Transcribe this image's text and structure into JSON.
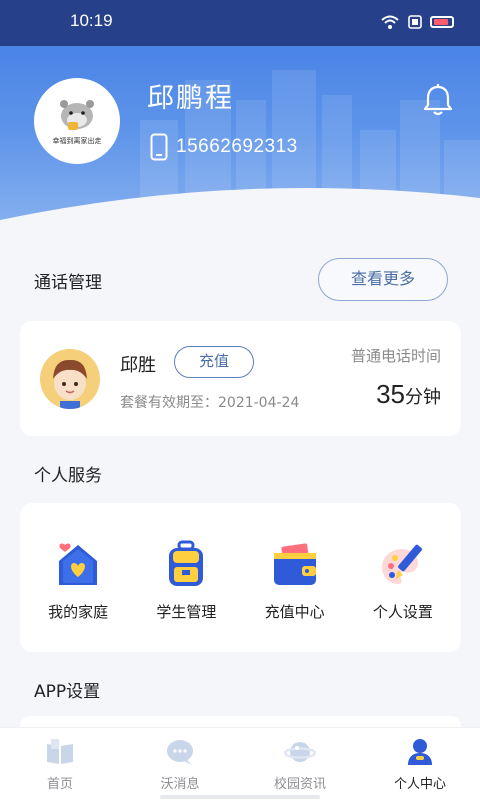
{
  "status_bar": {
    "time": "10:19",
    "icons": [
      "wifi-icon",
      "sim-icon",
      "battery-icon"
    ]
  },
  "profile": {
    "name": "邱鹏程",
    "phone": "15662692313",
    "avatar_caption": "幸福到离家出走",
    "bell_icon": "bell-icon"
  },
  "call_management": {
    "title": "通话管理",
    "more_label": "查看更多",
    "member": {
      "name": "邱胜",
      "recharge_label": "充值",
      "expiry": "套餐有效期至：2021-04-24",
      "call_type_label": "普通电话时间",
      "minutes": "35",
      "unit": "分钟"
    }
  },
  "personal_services": {
    "title": "个人服务",
    "items": [
      {
        "label": "我的家庭",
        "icon": "family-home-icon"
      },
      {
        "label": "学生管理",
        "icon": "backpack-icon"
      },
      {
        "label": "充值中心",
        "icon": "wallet-icon"
      },
      {
        "label": "个人设置",
        "icon": "palette-icon"
      }
    ]
  },
  "app_settings": {
    "title": "APP设置"
  },
  "bottom_nav": {
    "items": [
      {
        "label": "首页",
        "icon": "book-icon",
        "active": false
      },
      {
        "label": "沃消息",
        "icon": "chat-bubble-icon",
        "active": false
      },
      {
        "label": "校园资讯",
        "icon": "planet-icon",
        "active": false
      },
      {
        "label": "个人中心",
        "icon": "person-icon",
        "active": true
      }
    ]
  },
  "colors": {
    "primary": "#3f7be2",
    "accent_text": "#4b6ea6",
    "background": "#f4f6fa"
  }
}
